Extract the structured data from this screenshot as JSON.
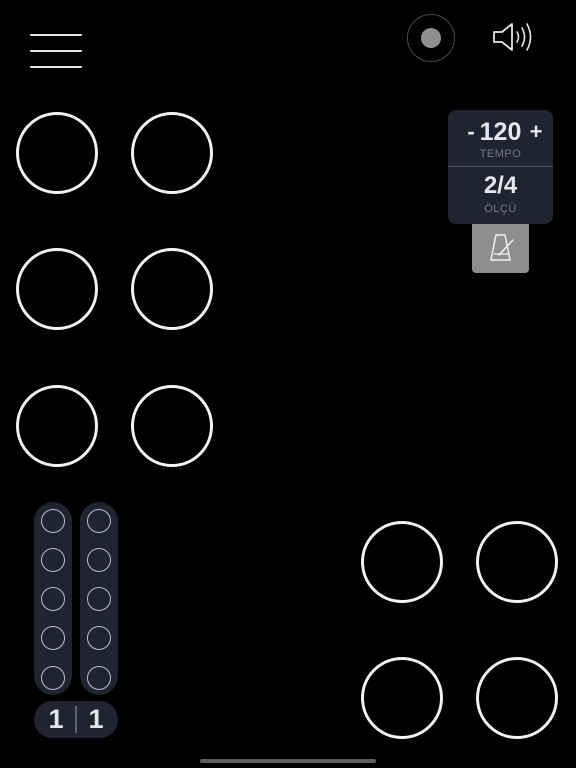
{
  "toolbar": {
    "menu_icon": "hamburger-menu-icon",
    "record_icon": "record-icon",
    "speaker_icon": "speaker-icon"
  },
  "tempo": {
    "minus_label": "-",
    "value": "120",
    "plus_label": "+",
    "label": "TEMPO"
  },
  "meter": {
    "value": "2/4",
    "label": "ÖLÇÜ"
  },
  "metronome": {
    "icon": "metronome-icon"
  },
  "steps": {
    "columns": 2,
    "per_column": 5
  },
  "counter": {
    "left": "1",
    "right": "1"
  },
  "colors": {
    "background": "#000000",
    "panel": "#1f2430",
    "pad_outline": "#f2f2f2",
    "metronome_button": "#8e8e8e",
    "label": "#727a8a"
  }
}
